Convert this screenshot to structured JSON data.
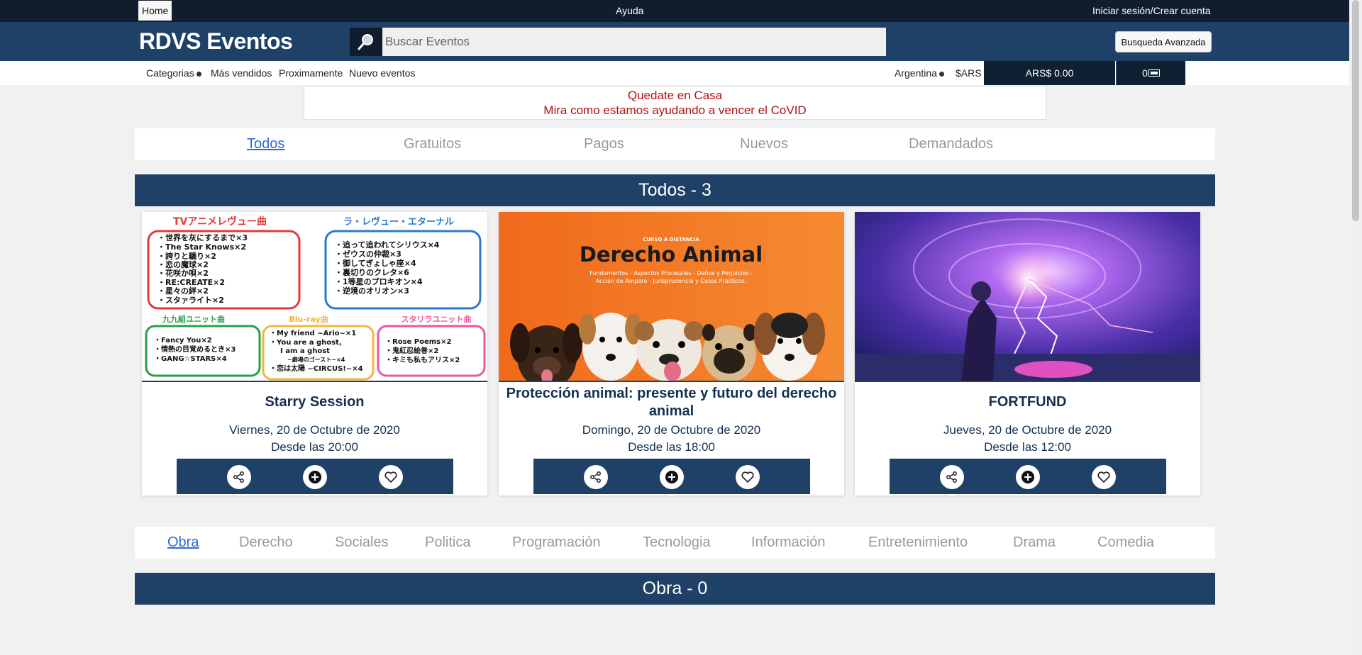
{
  "topbar": {
    "home": "Home",
    "help": "Ayuda",
    "login": "Iniciar sesión/Crear cuenta"
  },
  "header": {
    "brand": "RDVS Eventos",
    "search_placeholder": "Buscar Eventos",
    "advanced_search": "Busqueda Avanzada"
  },
  "subnav": {
    "categories": "Categorias",
    "best_sellers": "Más vendidos",
    "upcoming": "Proximamente",
    "new_events": "Nuevo eventos",
    "country": "Argentina",
    "currency": "$ARS",
    "cart_total": "ARS$ 0.00",
    "cart_count": "0"
  },
  "banner": {
    "line1": "Quedate en Casa",
    "line2": "Mira como estamos ayudando a vencer el CoVID"
  },
  "filter_tabs": [
    "Todos",
    "Gratuitos",
    "Pagos",
    "Nuevos",
    "Demandados"
  ],
  "section_todos": "Todos - 3",
  "events": [
    {
      "title": "Starry Session",
      "date": "Viernes, 20 de Octubre de 2020",
      "time": "Desde las 20:00"
    },
    {
      "title": "Protección animal: presente y futuro del derecho animal",
      "date": "Domingo, 20 de Octubre de 2020",
      "time": "Desde las 18:00"
    },
    {
      "title": "FORTFUND",
      "date": "Jueves, 20 de Octubre de 2020",
      "time": "Desde las 12:00"
    }
  ],
  "poster1": {
    "h1": "TVアニメレヴュー曲",
    "h2": "ラ・レヴュー・エターナル",
    "h3": "九九組ユニット曲",
    "h4": "Blu-ray曲",
    "h5": "スタリラユニット曲",
    "b1": [
      "・世界を灰にするまで×3",
      "・The Star Knows×2",
      "・誇りと驕り×2",
      "・恋の魔球×2",
      "・花咲か唄×2",
      "・RE:CREATE×2",
      "・星々の絆×2",
      "・スタァライト×2"
    ],
    "b2": [
      "・追って追われてシリウス×4",
      "・ゼウスの仲裁×3",
      "・御してぎょしゃ座×4",
      "・裏切りのクレタ×6",
      "・1等星のプロキオン×4",
      "・逆境のオリオン×3"
    ],
    "b3": [
      "・Fancy You×2",
      "・情熱の目覚めるとき×3",
      "・GANG☆STARS×4"
    ],
    "b4": [
      "・My friend ~Ario~×1",
      "・You are a ghost,",
      "I am a ghost",
      "~劇場のゴースト~×4",
      "・恋は太陽 ~CIRCUS!~×4"
    ],
    "b5": [
      "・Rose Poems×2",
      "・鬼紅忍絵巻×2",
      "・キミも私もアリス×2"
    ]
  },
  "poster2": {
    "kicker": "CURSO A DISTANCIA",
    "heading": "Derecho Animal",
    "sub1": "Fundamentos - Aspectos Procesales - Daños y Perjuicios -",
    "sub2": "Acción de Amparo - Jurisprudencia y Casos Prácticos."
  },
  "category_tabs": [
    "Obra",
    "Derecho",
    "Sociales",
    "Politica",
    "Programación",
    "Tecnologia",
    "Información",
    "Entretenimiento",
    "Drama",
    "Comedia"
  ],
  "section_obra": "Obra - 0",
  "colors": {
    "topbar": "#0f1d2e",
    "header": "#1f4167",
    "accent": "#2e6ad4",
    "banner_text": "#b01010"
  }
}
